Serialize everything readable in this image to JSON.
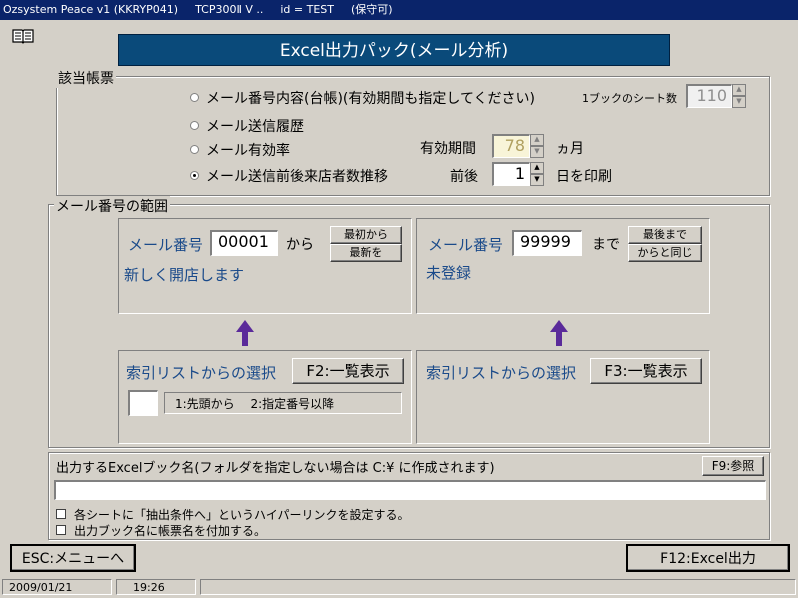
{
  "window": {
    "title_parts": [
      "Ozsystem Peace v1 (KKRYP041)",
      "TCP300Ⅱ V ..",
      "id = TEST",
      "(保守可)"
    ],
    "book_icon": "open-book-icon"
  },
  "header": {
    "title": "Excel出力パック(メール分析)"
  },
  "report_group": {
    "legend": "該当帳票",
    "options": [
      {
        "label": "メール番号内容(台帳)(有効期間も指定してください)",
        "checked": false
      },
      {
        "label": "メール送信履歴",
        "checked": false
      },
      {
        "label": "メール有効率",
        "checked": false
      },
      {
        "label": "メール送信前後来店者数推移",
        "checked": true
      }
    ],
    "sheet_count_label": "1ブックのシート数",
    "sheet_count_value": "110",
    "validity_label": "有効期間",
    "validity_value": "78",
    "validity_unit": "ヵ月",
    "before_after_label": "前後",
    "before_after_value": "1",
    "before_after_unit": "日を印刷"
  },
  "range_group": {
    "legend": "メール番号の範囲",
    "from": {
      "label": "メール番号",
      "value": "00001",
      "suffix": "から",
      "btn_first": "最初から",
      "btn_new": "最新を",
      "note": "新しく開店します"
    },
    "to": {
      "label": "メール番号",
      "value": "99999",
      "suffix": "まで",
      "btn_last": "最後まで",
      "btn_same": "からと同じ",
      "note": "未登録"
    },
    "index_left": {
      "label": "索引リストからの選択",
      "button": "F2:一覧表示",
      "mode_value": "",
      "mode_hint": "1:先頭から　 2:指定番号以降"
    },
    "index_right": {
      "label": "索引リストからの選択",
      "button": "F3:一覧表示"
    }
  },
  "output": {
    "label": "出力するExcelブック名(フォルダを指定しない場合は C:¥ に作成されます)",
    "browse_button": "F9:参照",
    "filename_value": "",
    "check_hyperlink": "各シートに「抽出条件へ」というハイパーリンクを設定する。",
    "check_report_name": "出力ブック名に帳票名を付加する。"
  },
  "footer": {
    "esc_button": "ESC:メニューへ",
    "f12_button": "F12:Excel出力"
  },
  "status": {
    "date": "2009/01/21",
    "time": "19:26"
  },
  "colors": {
    "title_band": "#0a4a7a",
    "titlebar": "#0a246a",
    "label_blue": "#1a4a8a",
    "arrow": "#5a2a9a"
  }
}
